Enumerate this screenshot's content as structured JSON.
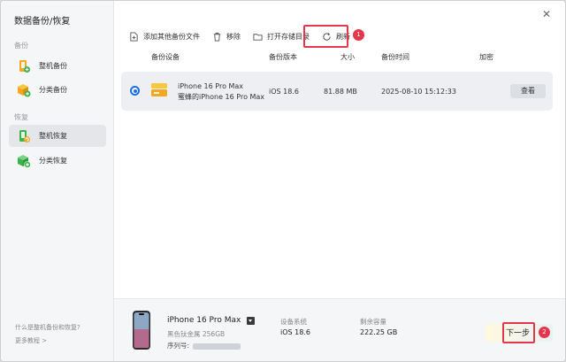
{
  "window": {
    "title": "数据备份/恢复"
  },
  "sidebar": {
    "backup_section": "备份",
    "restore_section": "恢复",
    "items": [
      {
        "label": "整机备份",
        "icon": "full-backup-icon"
      },
      {
        "label": "分类备份",
        "icon": "category-backup-icon"
      },
      {
        "label": "整机恢复",
        "icon": "full-restore-icon",
        "active": true
      },
      {
        "label": "分类恢复",
        "icon": "category-restore-icon"
      }
    ],
    "help_link": "什么是整机备份和恢复?",
    "more_tutorials": "更多教程 >"
  },
  "toolbar": {
    "add_other": "添加其他备份文件",
    "remove": "移除",
    "open_dir": "打开存储目录",
    "refresh": "刷新"
  },
  "annotations": {
    "badge1": "1",
    "badge2": "2"
  },
  "table": {
    "headers": {
      "device": "备份设备",
      "version": "备份版本",
      "size": "大小",
      "time": "备份时间",
      "encrypt": "加密"
    },
    "row": {
      "device_line1": "iPhone 16 Pro Max",
      "device_line2": "蜜蜂的iPhone 16 Pro Max",
      "version": "iOS 18.6",
      "size": "81.88 MB",
      "time": "2025-08-10 15:12:33",
      "view_label": "查看"
    }
  },
  "device": {
    "name": "iPhone 16 Pro Max",
    "color_storage": "黑色钛金属 256GB",
    "serial_label": "序列号:",
    "system_label": "设备系统",
    "system_value": "iOS 18.6",
    "capacity_label": "剩余容量",
    "capacity_value": "222.25 GB"
  },
  "actions": {
    "next": "下一步"
  },
  "colors": {
    "accent": "#1a6ff0",
    "highlight": "#e5374b",
    "green": "#3bb54a",
    "orange": "#f5a623"
  }
}
